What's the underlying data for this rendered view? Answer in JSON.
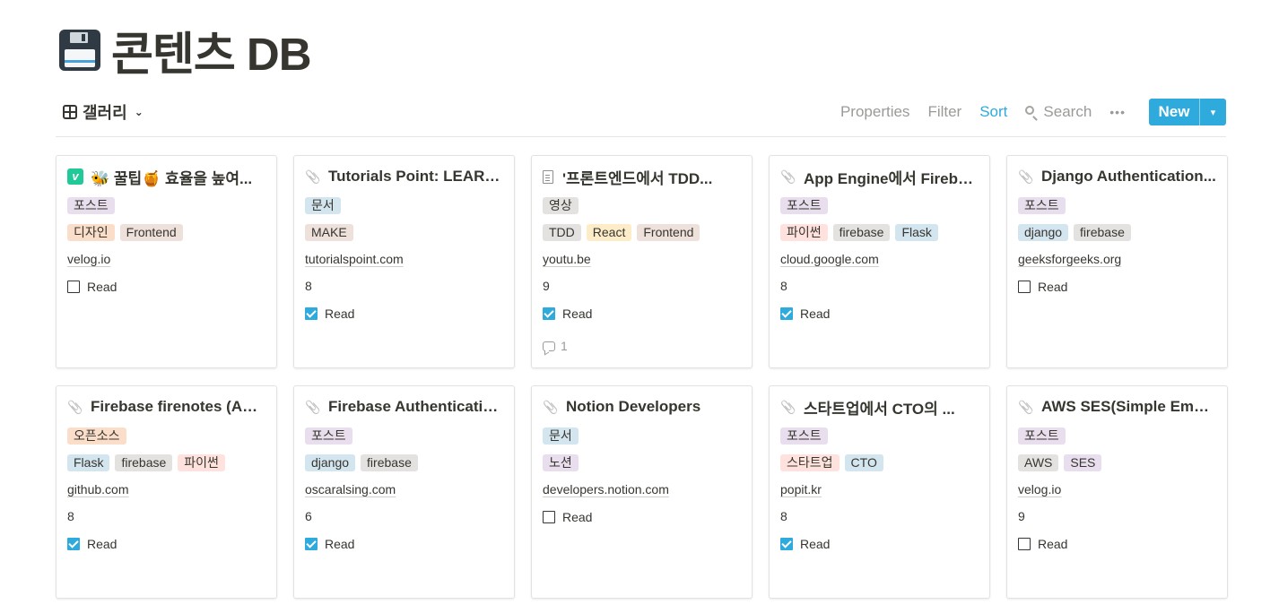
{
  "page": {
    "emoji_icon": "floppy-disk-icon",
    "title": "콘텐츠 DB"
  },
  "view": {
    "label": "갤러리"
  },
  "toolbar": {
    "properties": "Properties",
    "filter": "Filter",
    "sort": "Sort",
    "search": "Search",
    "more": "•••",
    "new_label": "New",
    "new_dropdown": "▾"
  },
  "colors": {
    "accent": "#2eaadc"
  },
  "cards": [
    {
      "icon": "velog",
      "title": "🐝 꿀팁🍯 효율을 높여...",
      "tags1": [
        {
          "text": "포스트",
          "color": "#e8deee"
        }
      ],
      "tags2": [
        {
          "text": "디자인",
          "color": "#fadec9"
        },
        {
          "text": "Frontend",
          "color": "#eee0da"
        }
      ],
      "url": "velog.io",
      "number": "",
      "read": false,
      "comments": ""
    },
    {
      "icon": "clip",
      "title": "Tutorials Point: LEARN...",
      "tags1": [
        {
          "text": "문서",
          "color": "#d3e5ef"
        }
      ],
      "tags2": [
        {
          "text": "MAKE",
          "color": "#eee0da"
        }
      ],
      "url": "tutorialspoint.com",
      "number": "8",
      "read": true,
      "comments": ""
    },
    {
      "icon": "doc",
      "title": "'프론트엔드에서 TDD...",
      "tags1": [
        {
          "text": "영상",
          "color": "#e3e2e0"
        }
      ],
      "tags2": [
        {
          "text": "TDD",
          "color": "#e3e2e0"
        },
        {
          "text": "React",
          "color": "#fdecc8"
        },
        {
          "text": "Frontend",
          "color": "#eee0da"
        }
      ],
      "url": "youtu.be",
      "number": "9",
      "read": true,
      "comments": "1"
    },
    {
      "icon": "clip",
      "title": "App Engine에서 Fireba...",
      "tags1": [
        {
          "text": "포스트",
          "color": "#e8deee"
        }
      ],
      "tags2": [
        {
          "text": "파이썬",
          "color": "#ffe2dd"
        },
        {
          "text": "firebase",
          "color": "#e3e2e0"
        },
        {
          "text": "Flask",
          "color": "#d3e5ef"
        }
      ],
      "url": "cloud.google.com",
      "number": "8",
      "read": true,
      "comments": ""
    },
    {
      "icon": "clip",
      "title": "Django Authentication...",
      "tags1": [
        {
          "text": "포스트",
          "color": "#e8deee"
        }
      ],
      "tags2": [
        {
          "text": "django",
          "color": "#d3e5ef"
        },
        {
          "text": "firebase",
          "color": "#e3e2e0"
        }
      ],
      "url": "geeksforgeeks.org",
      "number": "",
      "read": false,
      "comments": ""
    },
    {
      "icon": "clip",
      "title": "Firebase firenotes (Aut...",
      "tags1": [
        {
          "text": "오픈소스",
          "color": "#fadec9"
        }
      ],
      "tags2": [
        {
          "text": "Flask",
          "color": "#d3e5ef"
        },
        {
          "text": "firebase",
          "color": "#e3e2e0"
        },
        {
          "text": "파이썬",
          "color": "#ffe2dd"
        }
      ],
      "url": "github.com",
      "number": "8",
      "read": true,
      "comments": ""
    },
    {
      "icon": "clip",
      "title": "Firebase Authenticatio...",
      "tags1": [
        {
          "text": "포스트",
          "color": "#e8deee"
        }
      ],
      "tags2": [
        {
          "text": "django",
          "color": "#d3e5ef"
        },
        {
          "text": "firebase",
          "color": "#e3e2e0"
        }
      ],
      "url": "oscaralsing.com",
      "number": "6",
      "read": true,
      "comments": ""
    },
    {
      "icon": "clip",
      "title": "Notion Developers",
      "tags1": [
        {
          "text": "문서",
          "color": "#d3e5ef"
        }
      ],
      "tags2": [
        {
          "text": "노션",
          "color": "#e8deee"
        }
      ],
      "url": "developers.notion.com",
      "number": "",
      "read": false,
      "comments": ""
    },
    {
      "icon": "clip",
      "title": "스타트업에서 CTO의 ...",
      "tags1": [
        {
          "text": "포스트",
          "color": "#e8deee"
        }
      ],
      "tags2": [
        {
          "text": "스타트업",
          "color": "#ffe2dd"
        },
        {
          "text": "CTO",
          "color": "#d3e5ef"
        }
      ],
      "url": "popit.kr",
      "number": "8",
      "read": true,
      "comments": ""
    },
    {
      "icon": "clip",
      "title": "AWS SES(Simple Email...",
      "tags1": [
        {
          "text": "포스트",
          "color": "#e8deee"
        }
      ],
      "tags2": [
        {
          "text": "AWS",
          "color": "#e3e2e0"
        },
        {
          "text": "SES",
          "color": "#e8deee"
        }
      ],
      "url": "velog.io",
      "number": "9",
      "read": false,
      "comments": ""
    }
  ],
  "read_label": "Read"
}
